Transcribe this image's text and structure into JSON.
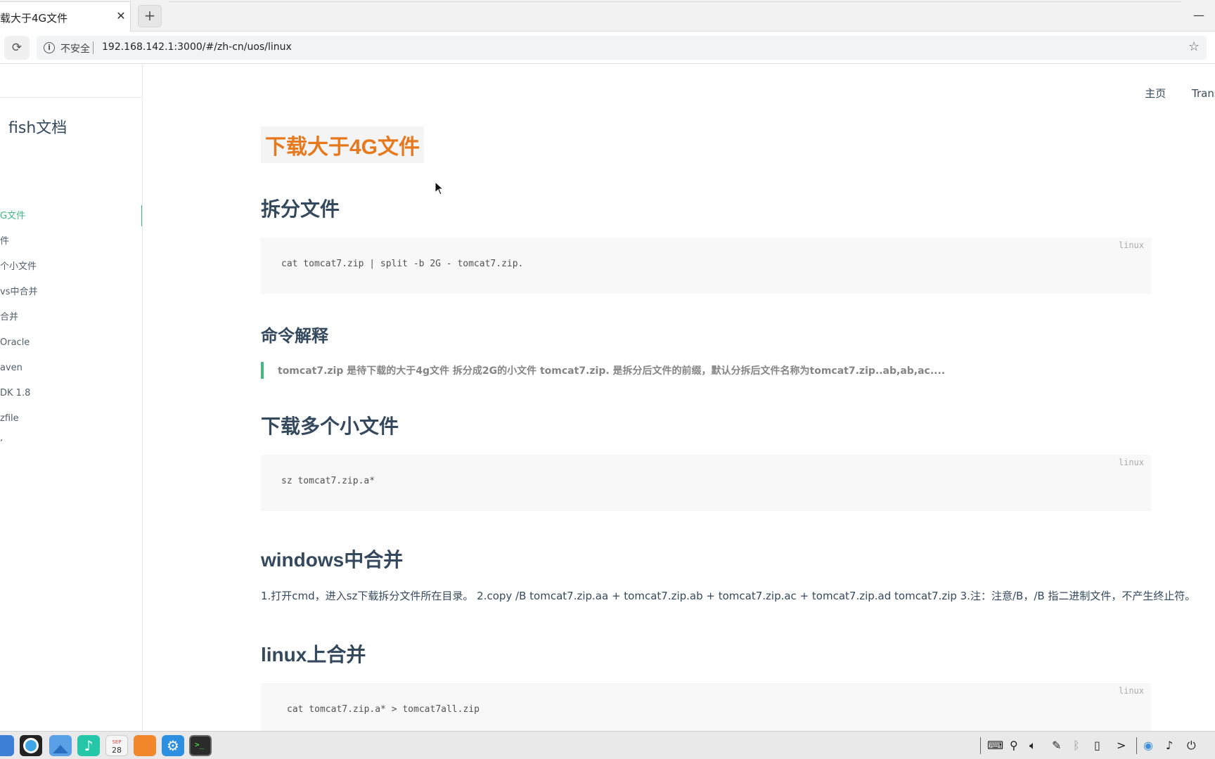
{
  "browser": {
    "tab_title": "载大于4G文件",
    "tab_close": "✕",
    "new_tab": "+",
    "minimize": "—",
    "reload_icon": "⟳",
    "security_label": "不安全",
    "url": "192.168.142.1:3000/#/zh-cn/uos/linux",
    "star_icon": "☆"
  },
  "sidebar": {
    "app_name": "fish文档",
    "items": [
      {
        "label": "G文件",
        "active": true
      },
      {
        "label": "件",
        "active": false
      },
      {
        "label": "个小文件",
        "active": false
      },
      {
        "label": "vs中合并",
        "active": false
      },
      {
        "label": "合并",
        "active": false
      },
      {
        "label": "Oracle",
        "active": false
      },
      {
        "label": "aven",
        "active": false
      },
      {
        "label": "DK 1.8",
        "active": false
      },
      {
        "label": "zfile",
        "active": false
      },
      {
        "label": "’",
        "active": false
      }
    ]
  },
  "topnav": {
    "home": "主页",
    "translate": "Transla"
  },
  "content": {
    "title": "下载大于4G文件",
    "sections": {
      "split": {
        "heading": "拆分文件",
        "lang": "linux",
        "code": "cat tomcat7.zip | split -b 2G - tomcat7.zip."
      },
      "explain": {
        "heading": "命令解释",
        "quote": "tomcat7.zip 是待下载的大于4g文件 拆分成2G的小文件 tomcat7.zip. 是拆分后文件的前缀，默认分拆后文件名称为tomcat7.zip..ab,ab,ac...."
      },
      "download": {
        "heading": "下载多个小文件",
        "lang": "linux",
        "code": "sz tomcat7.zip.a*"
      },
      "windows": {
        "heading": "windows中合并",
        "text": "1.打开cmd，进入sz下载拆分文件所在目录。 2.copy /B tomcat7.zip.aa + tomcat7.zip.ab + tomcat7.zip.ac + tomcat7.zip.ad tomcat7.zip 3.注：注意/B，/B 指二进制文件，不产生终止符。"
      },
      "linux": {
        "heading": "linux上合并",
        "lang": "linux",
        "code": "cat tomcat7.zip.a* > tomcat7all.zip"
      }
    }
  },
  "taskbar": {
    "calendar_month": "SEP",
    "calendar_day": "28",
    "tray_icons": [
      "keyboard-icon",
      "usb-icon",
      "volume-icon",
      "pen-icon",
      "bluetooth-icon",
      "device-icon",
      "expand-icon",
      "network-icon",
      "bell-icon",
      "power-icon"
    ],
    "expand_glyph": ">"
  },
  "colors": {
    "accent": "#42b983",
    "title_orange": "#e6781e",
    "text": "#34495e"
  }
}
